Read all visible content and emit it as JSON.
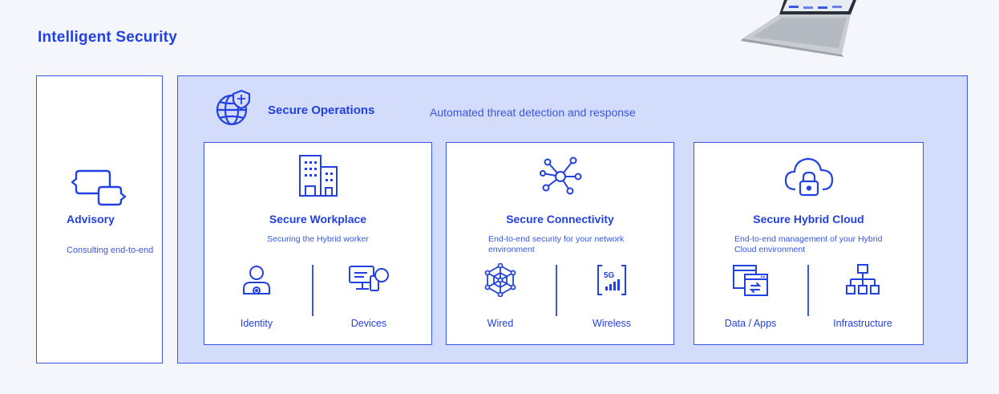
{
  "page": {
    "title": "Intelligent Security"
  },
  "advisory": {
    "name": "Advisory",
    "desc": "Consulting end-to-end"
  },
  "operations": {
    "name": "Secure Operations",
    "desc": "Automated threat detection and response"
  },
  "workplace": {
    "name": "Secure Workplace",
    "desc": "Securing the Hybrid worker",
    "items": [
      {
        "label": "Identity"
      },
      {
        "label": "Devices"
      }
    ]
  },
  "connectivity": {
    "name": "Secure Connectivity",
    "desc": "End-to-end security for your network environment",
    "items": [
      {
        "label": "Wired"
      },
      {
        "label": "Wireless"
      }
    ]
  },
  "cloud": {
    "name": "Secure Hybrid Cloud",
    "desc": "End-to-end management of your Hybrid Cloud environment",
    "items": [
      {
        "label": "Data / Apps"
      },
      {
        "label": "Infrastructure"
      }
    ]
  },
  "colors": {
    "accent": "#2341e0",
    "panel": "#d4dcfb",
    "border": "#3a57e8",
    "background": "#f4f6fc"
  },
  "icons": {
    "advisory": "chat-bubbles-icon",
    "operations": "globe-shield-icon",
    "workplace": "office-building-icon",
    "connectivity": "network-hub-icon",
    "cloud": "cloud-lock-icon",
    "identity": "user-identity-icon",
    "devices": "devices-icon",
    "wired": "mesh-network-icon",
    "wireless": "5g-signal-icon",
    "data_apps": "data-apps-icon",
    "infrastructure": "hierarchy-icon"
  }
}
